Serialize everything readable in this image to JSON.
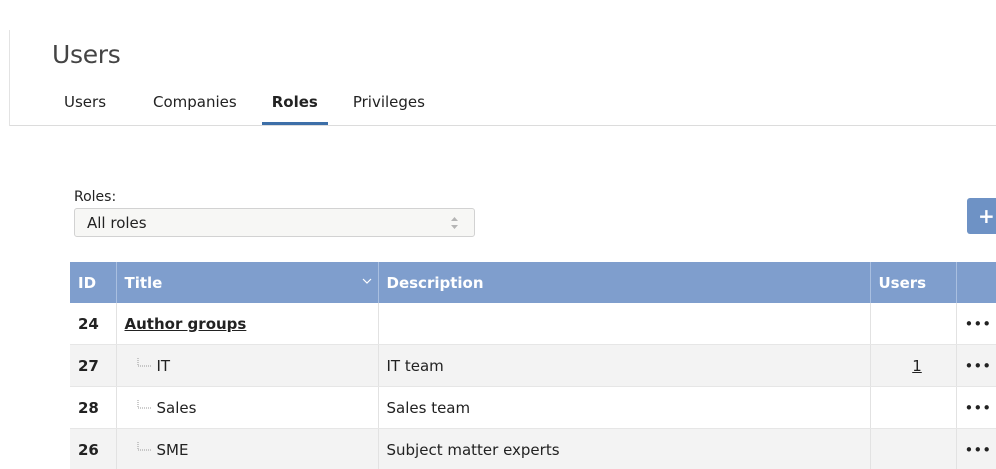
{
  "header": {
    "title": "Users"
  },
  "tabs": [
    {
      "label": "Users",
      "active": false
    },
    {
      "label": "Companies",
      "active": false
    },
    {
      "label": "Roles",
      "active": true
    },
    {
      "label": "Privileges",
      "active": false
    }
  ],
  "filter": {
    "label": "Roles:",
    "selected": "All roles"
  },
  "toolbar": {
    "add_label": "+"
  },
  "table": {
    "columns": {
      "id": "ID",
      "title": "Title",
      "description": "Description",
      "users": "Users",
      "actions": ""
    },
    "rows": [
      {
        "id": "24",
        "title": "Author groups",
        "description": "",
        "users": "",
        "actions": "•••",
        "is_group": true
      },
      {
        "id": "27",
        "title": "IT",
        "description": "IT team",
        "users": "1",
        "actions": "•••",
        "is_group": false
      },
      {
        "id": "28",
        "title": "Sales",
        "description": "Sales team",
        "users": "",
        "actions": "•••",
        "is_group": false
      },
      {
        "id": "26",
        "title": "SME",
        "description": "Subject matter experts",
        "users": "",
        "actions": "•••",
        "is_group": false
      }
    ]
  },
  "colors": {
    "accent": "#3d6fa8",
    "header_bg": "#7f9ecd",
    "add_button": "#6e92c5"
  },
  "icons": {
    "sort": "chevron-down-icon",
    "select": "updown-arrows-icon",
    "tree": "tree-branch-icon",
    "actions": "ellipsis-icon"
  }
}
